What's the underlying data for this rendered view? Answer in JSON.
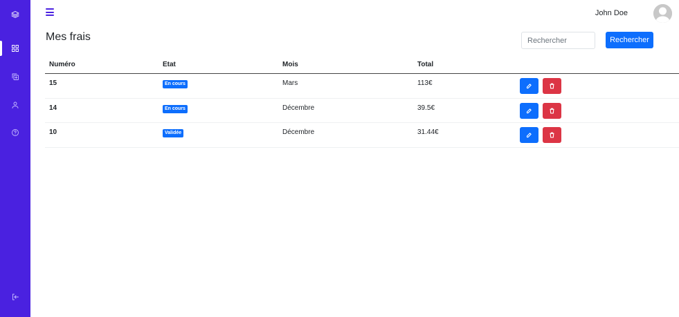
{
  "sidebar": {
    "items": [
      {
        "name": "logo-layers-icon",
        "icon": "layers"
      },
      {
        "name": "dashboard-grid-icon",
        "icon": "grid",
        "active": true
      },
      {
        "name": "copy-add-icon",
        "icon": "copy-plus"
      },
      {
        "name": "user-icon",
        "icon": "user"
      },
      {
        "name": "help-icon",
        "icon": "help-circle"
      },
      {
        "name": "logout-icon",
        "icon": "log-out"
      }
    ],
    "color": "#4a21e0"
  },
  "header": {
    "user_name": "John Doe"
  },
  "page": {
    "title": "Mes frais"
  },
  "search": {
    "placeholder": "Rechercher",
    "button_label": "Rechercher"
  },
  "table": {
    "headers": [
      "Numéro",
      "Etat",
      "Mois",
      "Total"
    ],
    "rows": [
      {
        "numero": "15",
        "etat": "En cours",
        "mois": "Mars",
        "total": "113€"
      },
      {
        "numero": "14",
        "etat": "En cours",
        "mois": "Décembre",
        "total": "39.5€"
      },
      {
        "numero": "10",
        "etat": "Validée",
        "mois": "Décembre",
        "total": "31.44€"
      }
    ]
  },
  "colors": {
    "primary": "#0d6efd",
    "danger": "#dc3545",
    "sidebar": "#4a21e0"
  }
}
